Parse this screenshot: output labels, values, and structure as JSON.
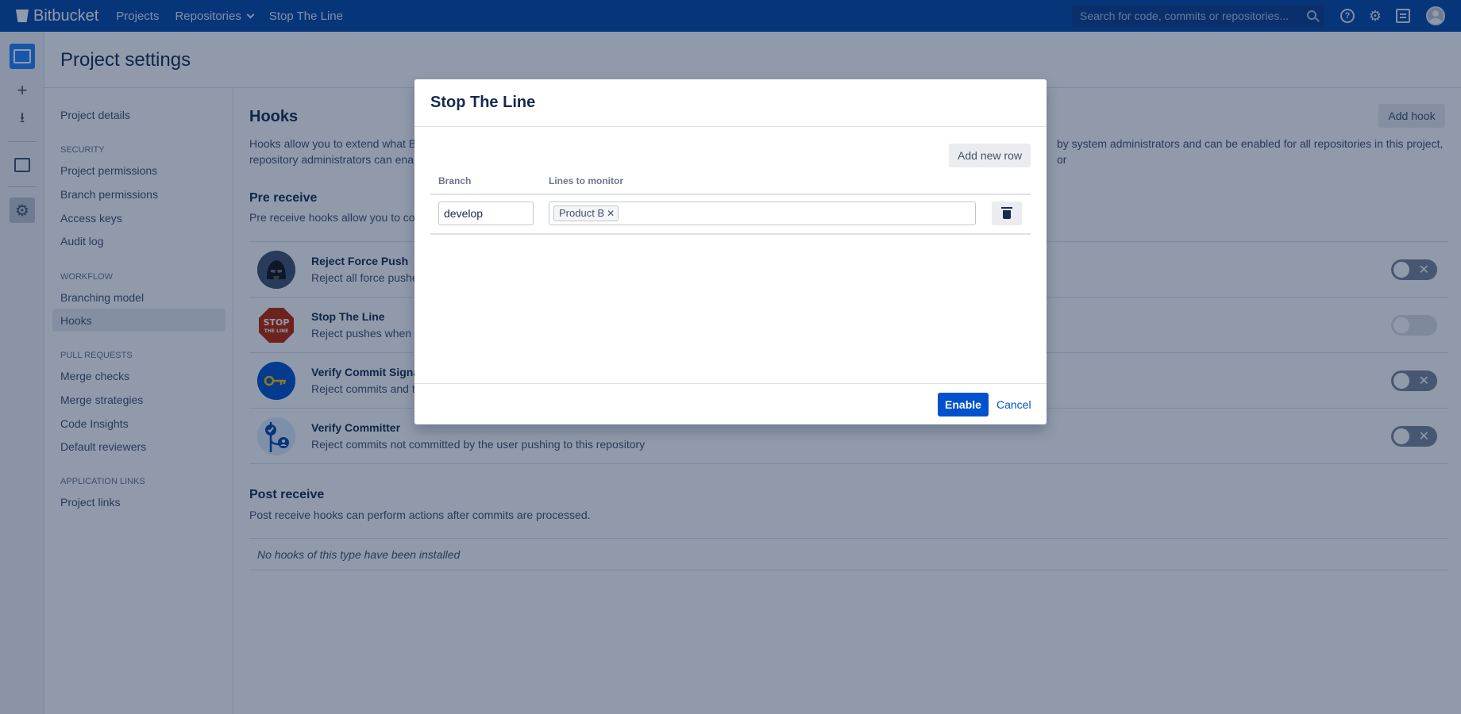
{
  "topbar": {
    "brand": "Bitbucket",
    "nav": [
      "Projects",
      "Repositories",
      "Stop The Line"
    ],
    "search_placeholder": "Search for code, commits or repositories..."
  },
  "page": {
    "title": "Project settings"
  },
  "sidenav": {
    "project_details": "Project details",
    "security_head": "SECURITY",
    "security": [
      "Project permissions",
      "Branch permissions",
      "Access keys",
      "Audit log"
    ],
    "workflow_head": "WORKFLOW",
    "workflow": [
      "Branching model",
      "Hooks"
    ],
    "pull_requests_head": "PULL REQUESTS",
    "pull_requests": [
      "Merge checks",
      "Merge strategies",
      "Code Insights",
      "Default reviewers"
    ],
    "app_links_head": "APPLICATION LINKS",
    "app_links": [
      "Project links"
    ]
  },
  "content": {
    "title": "Hooks",
    "add_hook": "Add hook",
    "desc_line1_left": "Hooks allow you to extend what B",
    "desc_line1_right": "by system administrators and can be enabled for all repositories in this project, or",
    "desc_line2": "repository administrators can ena",
    "pre_receive_title": "Pre receive",
    "pre_receive_desc": "Pre receive hooks allow you to co",
    "hooks": [
      {
        "name": "Reject Force Push",
        "desc": "Reject all force pushe",
        "enabled": false
      },
      {
        "name": "Stop The Line",
        "desc": "Reject pushes when c",
        "enabled": false
      },
      {
        "name": "Verify Commit Signat",
        "desc": "Reject commits and ta",
        "enabled": false
      },
      {
        "name": "Verify Committer",
        "desc": "Reject commits not committed by the user pushing to this repository",
        "enabled": false
      }
    ],
    "post_receive_title": "Post receive",
    "post_receive_desc": "Post receive hooks can perform actions after commits are processed.",
    "no_hooks": "No hooks of this type have been installed"
  },
  "dialog": {
    "title": "Stop The Line",
    "add_row": "Add new row",
    "col_branch": "Branch",
    "col_lines": "Lines to monitor",
    "row": {
      "branch": "develop",
      "tag": "Product B"
    },
    "enable": "Enable",
    "cancel": "Cancel"
  }
}
